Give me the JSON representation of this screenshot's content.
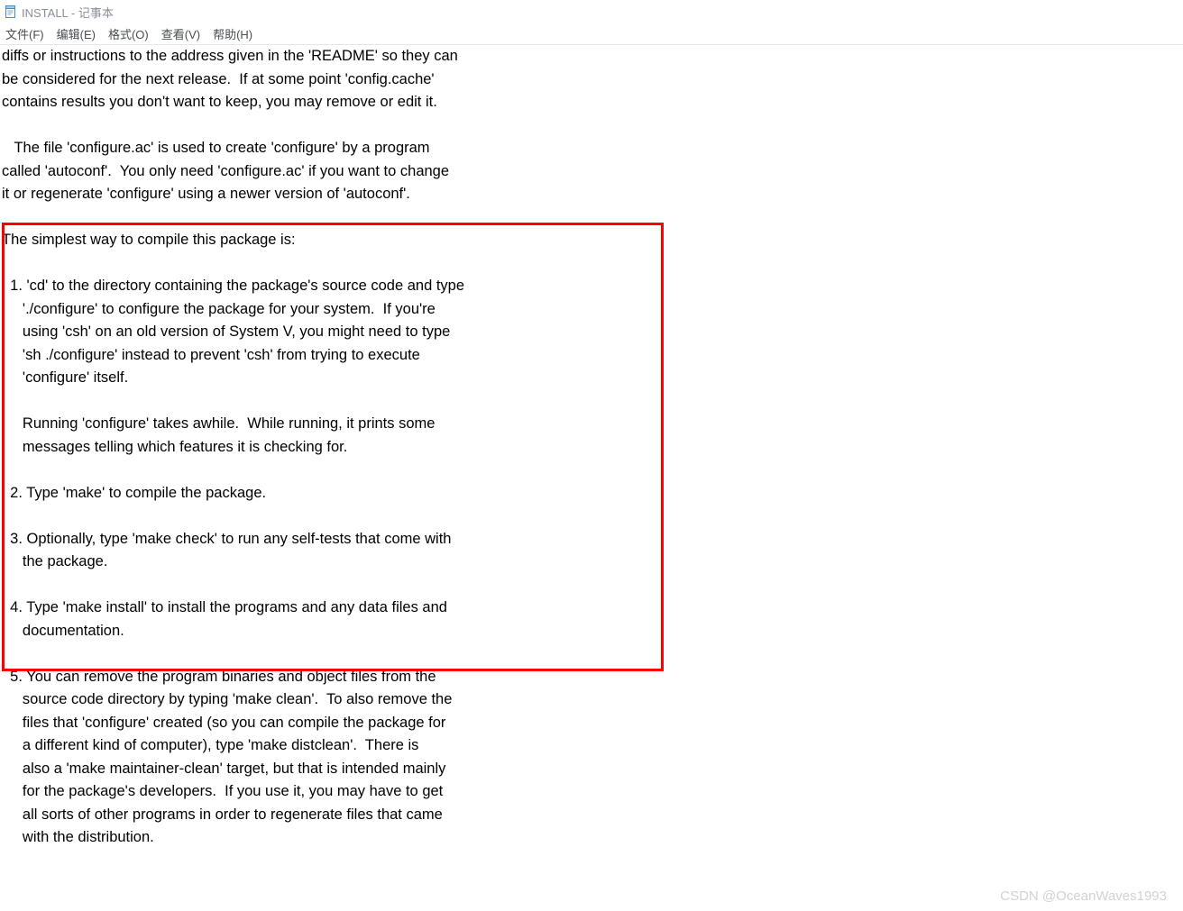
{
  "window": {
    "title": "INSTALL - 记事本"
  },
  "menubar": {
    "items": [
      "文件(F)",
      "编辑(E)",
      "格式(O)",
      "查看(V)",
      "帮助(H)"
    ]
  },
  "body": {
    "para1_l1": "diffs or instructions to the address given in the 'README' so they can",
    "para1_l2": "be considered for the next release.  If at some point 'config.cache'",
    "para1_l3": "contains results you don't want to keep, you may remove or edit it.",
    "para2_l1": "   The file 'configure.ac' is used to create 'configure' by a program",
    "para2_l2": "called 'autoconf'.  You only need 'configure.ac' if you want to change",
    "para2_l3": "it or regenerate 'configure' using a newer version of 'autoconf'.",
    "intro": "The simplest way to compile this package is:",
    "s1_l1": "  1. 'cd' to the directory containing the package's source code and type",
    "s1_l2": "     './configure' to configure the package for your system.  If you're",
    "s1_l3": "     using 'csh' on an old version of System V, you might need to type",
    "s1_l4": "     'sh ./configure' instead to prevent 'csh' from trying to execute",
    "s1_l5": "     'configure' itself.",
    "s1_l6": "     Running 'configure' takes awhile.  While running, it prints some",
    "s1_l7": "     messages telling which features it is checking for.",
    "s2_l1": "  2. Type 'make' to compile the package.",
    "s3_l1": "  3. Optionally, type 'make check' to run any self-tests that come with",
    "s3_l2": "     the package.",
    "s4_l1": "  4. Type 'make install' to install the programs and any data files and",
    "s4_l2": "     documentation.",
    "s5_l1": "  5. You can remove the program binaries and object files from the",
    "s5_l2": "     source code directory by typing 'make clean'.  To also remove the",
    "s5_l3": "     files that 'configure' created (so you can compile the package for",
    "s5_l4": "     a different kind of computer), type 'make distclean'.  There is",
    "s5_l5": "     also a 'make maintainer-clean' target, but that is intended mainly",
    "s5_l6": "     for the package's developers.  If you use it, you may have to get",
    "s5_l7": "     all sorts of other programs in order to regenerate files that came",
    "s5_l8": "     with the distribution."
  },
  "watermark": "CSDN @OceanWaves1993"
}
